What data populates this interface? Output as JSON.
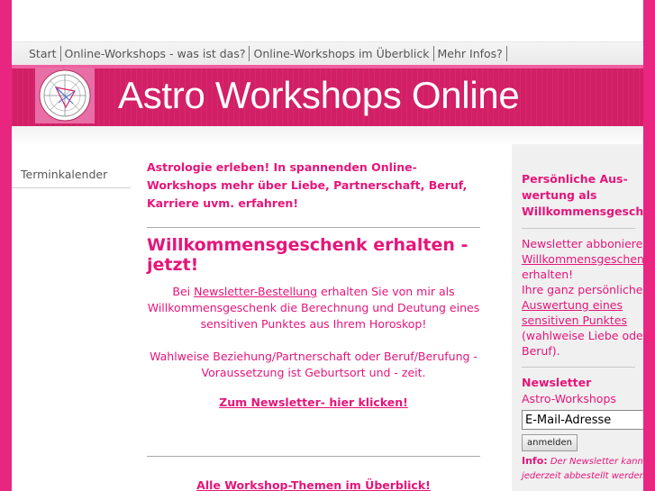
{
  "nav": {
    "items": [
      {
        "label": "Start"
      },
      {
        "label": "Online-Workshops - was ist das?"
      },
      {
        "label": "Online-Workshops im Überblick"
      },
      {
        "label": "Mehr Infos?"
      }
    ]
  },
  "banner": {
    "title": "Astro Workshops Online"
  },
  "sidebar": {
    "items": [
      {
        "label": "Terminkalender"
      }
    ]
  },
  "main": {
    "intro": "Astrologie erleben! In spannenden Online-Workshops mehr über Liebe, Partnerschaft, Beruf, Karriere uvm. erfahren!",
    "headline": "Willkommensgeschenk erhalten - jetzt!",
    "para1_before": "Bei ",
    "para1_link": "Newsletter-Bestellung",
    "para1_after": " erhalten Sie von mir als Willkommensgeschenk  die Berechnung und Deutung eines sensitiven Punktes aus Ihrem Horoskop!",
    "para2": "Wahlweise Beziehung/Partnerschaft oder Beruf/Berufung - Voraussetzung ist Geburtsort  und - zeit.",
    "cta_newsletter": "Zum Newsletter- hier klicken!",
    "cta_topics": "Alle Workshop-Themen im Überblick!"
  },
  "right": {
    "title": "Persönliche Aus-wertung als Willkommensgeschenk",
    "text1": "Newsletter abbonieren ",
    "link1": "Willkommensgeschenk",
    "text2": " erhalten!",
    "text3": "Ihre ganz persönliche ",
    "link2": "Auswertung eines sensitiven Punktes",
    "text4": " (wahlweise Liebe oder Beruf).",
    "newsletter_title": "Newsletter",
    "newsletter_subtitle": "Astro-Workshops",
    "email_value": "E-Mail-Adresse",
    "submit_label": "anmelden",
    "info_label": "Info:",
    "info_text": " Der Newsletter kann jederzeit abbestellt werden."
  },
  "colors": {
    "accent": "#e5157a",
    "banner": "#d21f66",
    "stripe": "#e8267f"
  },
  "icons": {
    "logo": "astrology-chart-icon"
  }
}
